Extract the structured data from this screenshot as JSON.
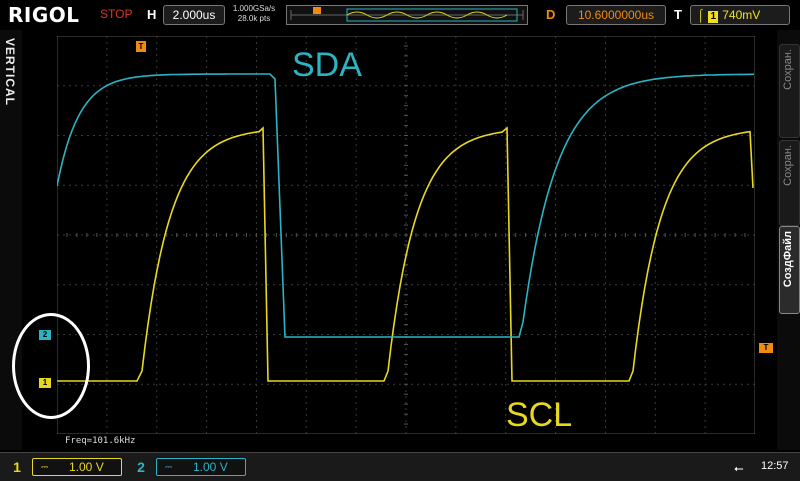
{
  "brand": "RIGOL",
  "status": "STOP",
  "horizontal": {
    "label": "H",
    "timebase": "2.000us"
  },
  "sampling": {
    "rate": "1.000GSa/s",
    "points": "28.0k pts"
  },
  "delay": {
    "label": "D",
    "value": "10.6000000us"
  },
  "trigger": {
    "label": "T",
    "source": "1",
    "level": "740mV",
    "marker": "T"
  },
  "left_panel": {
    "label": "VERTICAL"
  },
  "softkeys": [
    "Сохран.",
    "Сохран.",
    "СоздФайл"
  ],
  "traces": {
    "sda": {
      "label": "SDA",
      "color": "#2ab4c4",
      "marker": "2"
    },
    "scl": {
      "label": "SCL",
      "color": "#e8d820",
      "marker": "1"
    }
  },
  "freq": "Freq=101.6kHz",
  "channels": [
    {
      "num": "1",
      "coupling": "⎓",
      "scale": "1.00 V"
    },
    {
      "num": "2",
      "coupling": "⎓",
      "scale": "1.00 V"
    }
  ],
  "clock": "12:57"
}
